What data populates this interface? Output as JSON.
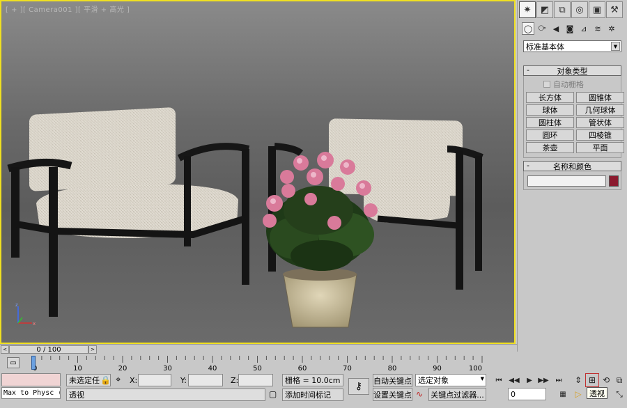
{
  "viewport": {
    "label": "[ + ][ Camera001 ][ 平滑 + 高光 ]"
  },
  "command_panel": {
    "tabs": [
      {
        "icon": "create-icon",
        "glyph": "✷"
      },
      {
        "icon": "modify-icon",
        "glyph": "◩"
      },
      {
        "icon": "hierarchy-icon",
        "glyph": "⧉"
      },
      {
        "icon": "motion-icon",
        "glyph": "◎"
      },
      {
        "icon": "display-icon",
        "glyph": "▣"
      },
      {
        "icon": "utilities-icon",
        "glyph": "⚒"
      }
    ],
    "subtabs": [
      {
        "icon": "geometry-icon",
        "glyph": "◯"
      },
      {
        "icon": "shapes-icon",
        "glyph": "⧂"
      },
      {
        "icon": "lights-icon",
        "glyph": "◀"
      },
      {
        "icon": "cameras-icon",
        "glyph": "◙"
      },
      {
        "icon": "helpers-icon",
        "glyph": "⊿"
      },
      {
        "icon": "spacewarps-icon",
        "glyph": "≋"
      },
      {
        "icon": "systems-icon",
        "glyph": "✲"
      }
    ],
    "category": "标准基本体",
    "object_type_title": "对象类型",
    "autogrid_label": "自动栅格",
    "objects": [
      "长方体",
      "圆锥体",
      "球体",
      "几何球体",
      "圆柱体",
      "管状体",
      "圆环",
      "四棱锥",
      "茶壶",
      "平面"
    ],
    "name_color_title": "名称和颜色",
    "rollout_minus": "-",
    "object_color": "#8b1a2e"
  },
  "time_slider": {
    "position": "0 / 100",
    "left_arrow": "<",
    "right_arrow": ">"
  },
  "trackbar": {
    "ticks": [
      "0",
      "10",
      "20",
      "30",
      "40",
      "50",
      "60",
      "70",
      "80",
      "90",
      "100"
    ]
  },
  "status": {
    "maxscript_text": "Max to Physc (",
    "selection": "未选定任",
    "x_label": "X:",
    "y_label": "Y:",
    "z_label": "Z:",
    "grid": "栅格 = 10.0cm",
    "prompt": "透视",
    "add_time_tag": "添加时间标记",
    "auto_key": "自动关键点",
    "set_key": "设置关键点",
    "selected_object": "选定对象",
    "key_filters": "关键点过滤器...",
    "frame_value": "0",
    "tooltip": "透视"
  }
}
